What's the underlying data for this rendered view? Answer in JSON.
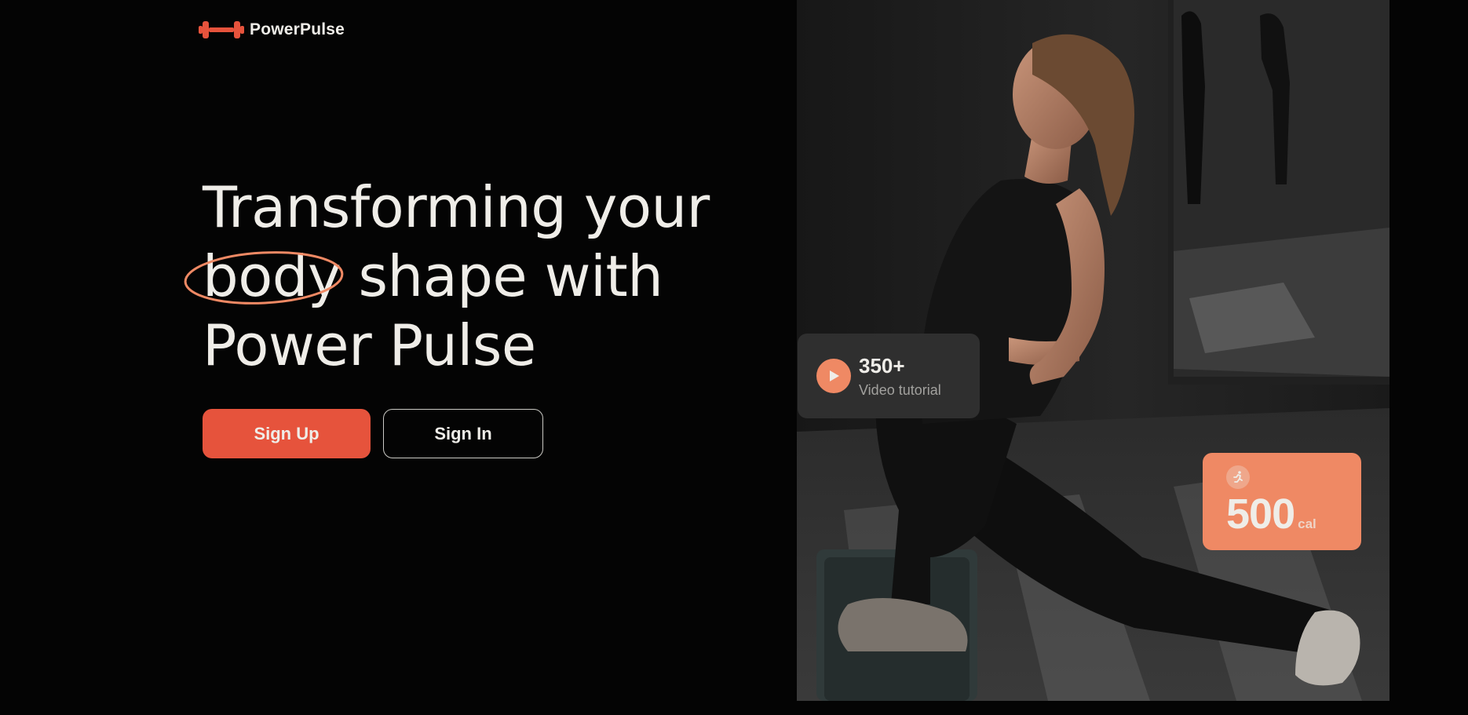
{
  "brand": {
    "name": "PowerPulse",
    "logo_icon": "dumbbell-icon",
    "accent_color": "#E6533C"
  },
  "hero": {
    "headline": {
      "line1": "Transforming your",
      "highlight_word": "body",
      "line2_rest": " shape with",
      "line3": "Power Pulse"
    },
    "highlight_color": "#EF8964",
    "image_description_icon": "woman-doing-lunge-photo"
  },
  "actions": {
    "signup_label": "Sign Up",
    "signin_label": "Sign In"
  },
  "video_card": {
    "icon": "play-icon",
    "count": "350+",
    "label": "Video tutorial"
  },
  "calories_card": {
    "icon": "running-icon",
    "value": "500",
    "unit": "cal",
    "color": "#EF8964"
  }
}
